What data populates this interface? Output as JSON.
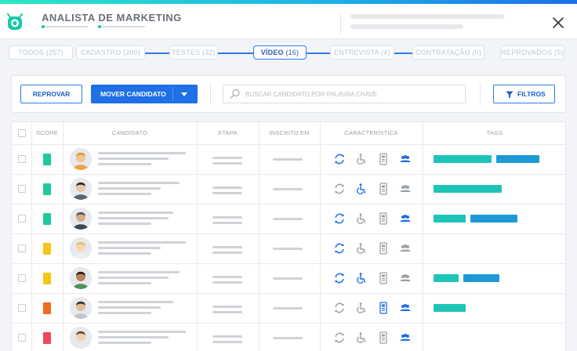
{
  "header": {
    "title": "ANALISTA DE MARKETING"
  },
  "stages": [
    {
      "label": "TODOS (257)",
      "active": false
    },
    {
      "label": "CADASTRO (200)",
      "active": false
    },
    {
      "label": "TESTES (32)",
      "active": false
    },
    {
      "name": "VÍDEO",
      "count": "(16)",
      "active": true
    },
    {
      "label": "ENTREVISTA (4)",
      "active": false
    },
    {
      "label": "CONTRATAÇÃO (0)",
      "active": false
    },
    {
      "label": "REPROVADOS (5)",
      "active": false
    }
  ],
  "toolbar": {
    "reject_label": "REPROVAR",
    "move_label": "MOVER CANDIDATO",
    "search_placeholder": "BUSCAR CANDIDATO POR PALAVRA CHAVE",
    "filters_label": "FILTROS"
  },
  "table": {
    "columns": [
      "SCORE",
      "CANDIDATO",
      "ETAPA",
      "INSCRITO EM",
      "CARACTERÍSTICA",
      "TAGS"
    ],
    "rows": [
      {
        "score_color": "#21c99e",
        "sync": true,
        "accessible": false,
        "badge": false,
        "group": true,
        "tags": [
          {
            "color": "#1fc4b9",
            "w": 74
          },
          {
            "color": "#1d9ad6",
            "w": 55
          }
        ]
      },
      {
        "score_color": "#21c99e",
        "sync": false,
        "accessible": true,
        "badge": false,
        "group": false,
        "tags": [
          {
            "color": "#1fc4b9",
            "w": 87
          }
        ]
      },
      {
        "score_color": "#21c99e",
        "sync": true,
        "accessible": false,
        "badge": false,
        "group": true,
        "tags": [
          {
            "color": "#1fc4b9",
            "w": 41
          },
          {
            "color": "#1d9ad6",
            "w": 60
          }
        ]
      },
      {
        "score_color": "#f5c518",
        "sync": true,
        "accessible": false,
        "badge": false,
        "group": false,
        "tags": []
      },
      {
        "score_color": "#f5c518",
        "sync": true,
        "accessible": true,
        "badge": false,
        "group": false,
        "tags": [
          {
            "color": "#1fc4b9",
            "w": 32
          },
          {
            "color": "#1d9ad6",
            "w": 46
          }
        ]
      },
      {
        "score_color": "#f26a1b",
        "sync": false,
        "accessible": false,
        "badge": true,
        "group": true,
        "tags": [
          {
            "color": "#1fc4b9",
            "w": 41
          }
        ]
      },
      {
        "score_color": "#f0475c",
        "sync": false,
        "accessible": false,
        "badge": false,
        "group": true,
        "tags": []
      }
    ]
  },
  "colors": {
    "accent": "#1f6fe5",
    "active_icon": "#1f6fe5",
    "inactive_icon": "#9aa0a7"
  }
}
